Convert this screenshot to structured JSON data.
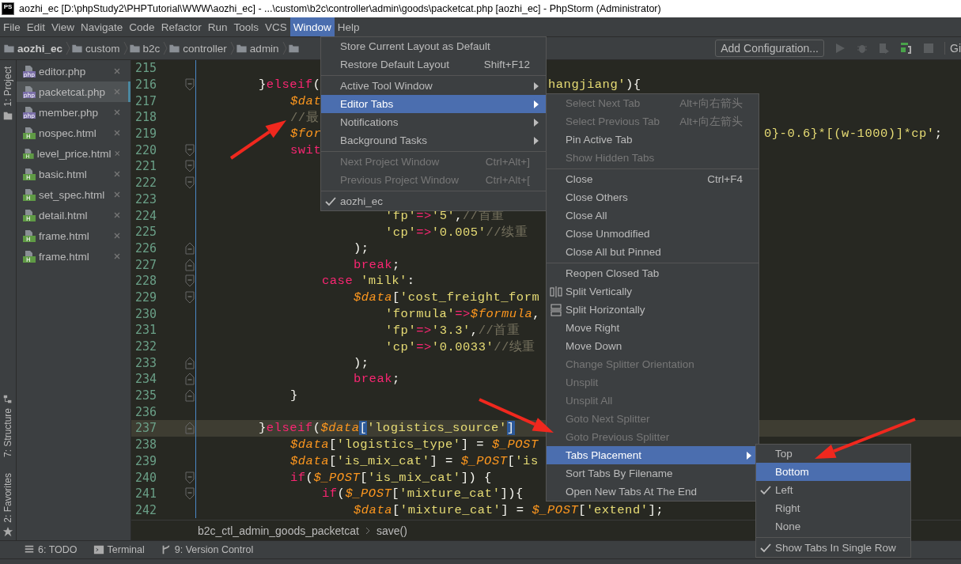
{
  "window": {
    "app_icon_text": "PS",
    "title": "aozhi_ec [D:\\phpStudy2\\PHPTutorial\\WWW\\aozhi_ec] - ...\\custom\\b2c\\controller\\admin\\goods\\packetcat.php [aozhi_ec] - PhpStorm (Administrator)"
  },
  "menu_bar": [
    {
      "label": "File",
      "selected": false
    },
    {
      "label": "Edit",
      "selected": false
    },
    {
      "label": "View",
      "selected": false
    },
    {
      "label": "Navigate",
      "selected": false
    },
    {
      "label": "Code",
      "selected": false
    },
    {
      "label": "Refactor",
      "selected": false
    },
    {
      "label": "Run",
      "selected": false
    },
    {
      "label": "Tools",
      "selected": false
    },
    {
      "label": "VCS",
      "selected": false
    },
    {
      "label": "Window",
      "selected": true
    },
    {
      "label": "Help",
      "selected": false
    }
  ],
  "navigation_bar": {
    "crumbs": [
      "aozhi_ec",
      "custom",
      "b2c",
      "controller",
      "admin"
    ],
    "run_config_button": "Add Configuration...",
    "vcs_label": "Gi"
  },
  "tool_windows_top": [
    {
      "label": "1: Project",
      "kind": "project"
    }
  ],
  "tool_windows_bottom": [
    {
      "label": "7: Structure",
      "kind": "structure"
    },
    {
      "label": "2: Favorites",
      "kind": "favorites"
    }
  ],
  "file_tabs": [
    {
      "name": "editor.php",
      "kind": "php",
      "badge": "php",
      "selected": false
    },
    {
      "name": "packetcat.php",
      "kind": "php",
      "badge": "php",
      "selected": true
    },
    {
      "name": "member.php",
      "kind": "php",
      "badge": "php",
      "selected": false
    },
    {
      "name": "nospec.html",
      "kind": "html",
      "badge": "H",
      "selected": false
    },
    {
      "name": "level_price.html",
      "kind": "html",
      "badge": "H",
      "selected": false
    },
    {
      "name": "basic.html",
      "kind": "html",
      "badge": "H",
      "selected": false
    },
    {
      "name": "set_spec.html",
      "kind": "html",
      "badge": "H",
      "selected": false
    },
    {
      "name": "detail.html",
      "kind": "html",
      "badge": "H",
      "selected": false
    },
    {
      "name": "frame.html",
      "kind": "html",
      "badge": "H",
      "selected": false
    },
    {
      "name": "frame.html",
      "kind": "html",
      "badge": "H",
      "selected": false
    }
  ],
  "editor": {
    "lines": [
      {
        "number": "215",
        "kind": "plain",
        "current": false
      },
      {
        "number": "216",
        "kind": "opener",
        "current": false,
        "tokens": [
          {
            "text": "        }",
            "kind": "plain"
          },
          {
            "text": "elseif",
            "kind": "keyword"
          },
          {
            "text": "(",
            "kind": "plain"
          }
        ],
        "tail": {
          "kind": "menu",
          "tokens": [
            {
              "text": "hangjiang'",
              "kind": "string"
            },
            {
              "text": "){",
              "kind": "plain"
            }
          ]
        }
      },
      {
        "number": "217",
        "kind": "plain",
        "current": false,
        "tokens": [
          {
            "text": "            $dat",
            "kind": "variable"
          }
        ]
      },
      {
        "number": "218",
        "kind": "plain",
        "current": false,
        "tokens": [
          {
            "text": "            //最",
            "kind": "comment"
          }
        ]
      },
      {
        "number": "219",
        "kind": "plain",
        "current": false,
        "tokens": [
          {
            "text": "            $for",
            "kind": "variable"
          }
        ],
        "tail": {
          "kind": "submenu",
          "tokens": [
            {
              "text": "0}-0.6}*[(w-1000)]*cp'",
              "kind": "string"
            },
            {
              "text": ";",
              "kind": "plain"
            }
          ]
        }
      },
      {
        "number": "220",
        "kind": "opener",
        "current": false,
        "tokens": [
          {
            "text": "            swit",
            "kind": "keyword"
          }
        ]
      },
      {
        "number": "221",
        "kind": "opener",
        "current": false
      },
      {
        "number": "222",
        "kind": "opener",
        "current": false
      },
      {
        "number": "223",
        "kind": "plain",
        "current": false
      },
      {
        "number": "224",
        "kind": "plain",
        "current": false,
        "tokens": [
          {
            "text": "                        'fp'",
            "kind": "string"
          },
          {
            "text": "=>",
            "kind": "operator"
          },
          {
            "text": "'5'",
            "kind": "string"
          },
          {
            "text": ",",
            "kind": "plain"
          },
          {
            "text": "//首重",
            "kind": "comment"
          }
        ]
      },
      {
        "number": "225",
        "kind": "plain",
        "current": false,
        "tokens": [
          {
            "text": "                        'cp'",
            "kind": "string"
          },
          {
            "text": "=>",
            "kind": "operator"
          },
          {
            "text": "'0.005'",
            "kind": "string"
          },
          {
            "text": "//续重",
            "kind": "comment"
          }
        ]
      },
      {
        "number": "226",
        "kind": "closer",
        "current": false,
        "tokens": [
          {
            "text": "                    );",
            "kind": "plain"
          }
        ]
      },
      {
        "number": "227",
        "kind": "closer",
        "current": false,
        "tokens": [
          {
            "text": "                    break",
            "kind": "keyword"
          },
          {
            "text": ";",
            "kind": "plain"
          }
        ]
      },
      {
        "number": "228",
        "kind": "opener",
        "current": false,
        "tokens": [
          {
            "text": "                case",
            "kind": "keyword"
          },
          {
            "text": " 'milk'",
            "kind": "string"
          },
          {
            "text": ":",
            "kind": "plain"
          }
        ]
      },
      {
        "number": "229",
        "kind": "opener",
        "current": false,
        "tokens": [
          {
            "text": "                    $data",
            "kind": "variable"
          },
          {
            "text": "[",
            "kind": "plain"
          },
          {
            "text": "'cost_freight_form",
            "kind": "string"
          }
        ]
      },
      {
        "number": "230",
        "kind": "plain",
        "current": false,
        "tokens": [
          {
            "text": "                        'formula'",
            "kind": "string"
          },
          {
            "text": "=>",
            "kind": "operator"
          },
          {
            "text": "$formula",
            "kind": "variable"
          },
          {
            "text": ",",
            "kind": "plain"
          }
        ]
      },
      {
        "number": "231",
        "kind": "plain",
        "current": false,
        "tokens": [
          {
            "text": "                        'fp'",
            "kind": "string"
          },
          {
            "text": "=>",
            "kind": "operator"
          },
          {
            "text": "'3.3'",
            "kind": "string"
          },
          {
            "text": ",",
            "kind": "plain"
          },
          {
            "text": "//首重",
            "kind": "comment"
          }
        ]
      },
      {
        "number": "232",
        "kind": "plain",
        "current": false,
        "tokens": [
          {
            "text": "                        'cp'",
            "kind": "string"
          },
          {
            "text": "=>",
            "kind": "operator"
          },
          {
            "text": "'0.0033'",
            "kind": "string"
          },
          {
            "text": "//续重",
            "kind": "comment"
          }
        ]
      },
      {
        "number": "233",
        "kind": "closer",
        "current": false,
        "tokens": [
          {
            "text": "                    );",
            "kind": "plain"
          }
        ]
      },
      {
        "number": "234",
        "kind": "closer",
        "current": false,
        "tokens": [
          {
            "text": "                    break",
            "kind": "keyword"
          },
          {
            "text": ";",
            "kind": "plain"
          }
        ]
      },
      {
        "number": "235",
        "kind": "closer",
        "current": false,
        "tokens": [
          {
            "text": "            }",
            "kind": "plain"
          }
        ]
      },
      {
        "number": "236",
        "kind": "plain",
        "current": false
      },
      {
        "number": "237",
        "kind": "closer",
        "current": true,
        "tokens": [
          {
            "text": "        }",
            "kind": "plain"
          },
          {
            "text": "elseif",
            "kind": "keyword"
          },
          {
            "text": "(",
            "kind": "plain"
          },
          {
            "text": "$data",
            "kind": "variable"
          },
          {
            "text": "[",
            "kind": "match"
          },
          {
            "text": "'logistics_source'",
            "kind": "string"
          },
          {
            "text": "]",
            "kind": "match"
          }
        ]
      },
      {
        "number": "238",
        "kind": "plain",
        "current": false,
        "tokens": [
          {
            "text": "            $data",
            "kind": "variable"
          },
          {
            "text": "[",
            "kind": "plain"
          },
          {
            "text": "'logistics_type'",
            "kind": "string"
          },
          {
            "text": "] = ",
            "kind": "plain"
          },
          {
            "text": "$_POST",
            "kind": "variable"
          }
        ]
      },
      {
        "number": "239",
        "kind": "plain",
        "current": false,
        "tokens": [
          {
            "text": "            $data",
            "kind": "variable"
          },
          {
            "text": "[",
            "kind": "plain"
          },
          {
            "text": "'is_mix_cat'",
            "kind": "string"
          },
          {
            "text": "] = ",
            "kind": "plain"
          },
          {
            "text": "$_POST",
            "kind": "variable"
          },
          {
            "text": "[",
            "kind": "plain"
          },
          {
            "text": "'is",
            "kind": "string"
          }
        ]
      },
      {
        "number": "240",
        "kind": "opener",
        "current": false,
        "tokens": [
          {
            "text": "            if",
            "kind": "keyword"
          },
          {
            "text": "(",
            "kind": "plain"
          },
          {
            "text": "$_POST",
            "kind": "variable"
          },
          {
            "text": "[",
            "kind": "plain"
          },
          {
            "text": "'is_mix_cat'",
            "kind": "string"
          },
          {
            "text": "]) {",
            "kind": "plain"
          }
        ]
      },
      {
        "number": "241",
        "kind": "opener",
        "current": false,
        "tokens": [
          {
            "text": "                if",
            "kind": "keyword"
          },
          {
            "text": "(",
            "kind": "plain"
          },
          {
            "text": "$_POST",
            "kind": "variable"
          },
          {
            "text": "[",
            "kind": "plain"
          },
          {
            "text": "'mixture_cat'",
            "kind": "string"
          },
          {
            "text": "]){",
            "kind": "plain"
          }
        ]
      },
      {
        "number": "242",
        "kind": "plain",
        "current": false,
        "tokens": [
          {
            "text": "                    $data",
            "kind": "variable"
          },
          {
            "text": "[",
            "kind": "plain"
          },
          {
            "text": "'mixture_cat'",
            "kind": "string"
          },
          {
            "text": "] = ",
            "kind": "plain"
          },
          {
            "text": "$_POST",
            "kind": "variable"
          },
          {
            "text": "[",
            "kind": "plain"
          },
          {
            "text": "'extend'",
            "kind": "string"
          },
          {
            "text": "];",
            "kind": "plain"
          }
        ]
      }
    ],
    "breadcrumb": [
      "b2c_ctl_admin_goods_packetcat",
      "save()"
    ]
  },
  "bottom_toolbar": [
    {
      "label": "6: TODO",
      "kind": "todo"
    },
    {
      "label": "Terminal",
      "kind": "terminal"
    },
    {
      "label": "9: Version Control",
      "kind": "vcs"
    }
  ],
  "window_menu": [
    {
      "kind": "item",
      "label": "Store Current Layout as Default",
      "submenu": false,
      "disabled": false,
      "selected": false,
      "checked": false
    },
    {
      "kind": "item",
      "label": "Restore Default Layout",
      "shortcut": "Shift+F12",
      "submenu": false,
      "disabled": false,
      "selected": false,
      "checked": false
    },
    {
      "kind": "separator"
    },
    {
      "kind": "item",
      "label": "Active Tool Window",
      "submenu": true,
      "disabled": false,
      "selected": false,
      "checked": false
    },
    {
      "kind": "item",
      "label": "Editor Tabs",
      "submenu": true,
      "disabled": false,
      "selected": true,
      "checked": false
    },
    {
      "kind": "item",
      "label": "Notifications",
      "submenu": true,
      "disabled": false,
      "selected": false,
      "checked": false
    },
    {
      "kind": "item",
      "label": "Background Tasks",
      "submenu": true,
      "disabled": false,
      "selected": false,
      "checked": false
    },
    {
      "kind": "separator"
    },
    {
      "kind": "item",
      "label": "Next Project Window",
      "shortcut": "Ctrl+Alt+]",
      "submenu": false,
      "disabled": true,
      "selected": false,
      "checked": false
    },
    {
      "kind": "item",
      "label": "Previous Project Window",
      "shortcut": "Ctrl+Alt+[",
      "submenu": false,
      "disabled": true,
      "selected": false,
      "checked": false
    },
    {
      "kind": "separator"
    },
    {
      "kind": "item",
      "label": "aozhi_ec",
      "submenu": false,
      "disabled": false,
      "selected": false,
      "checked": true
    }
  ],
  "editor_tabs_menu": [
    {
      "kind": "item",
      "label": "Select Next Tab",
      "shortcut": "Alt+向右箭头",
      "submenu": false,
      "disabled": true,
      "selected": false,
      "checked": false
    },
    {
      "kind": "item",
      "label": "Select Previous Tab",
      "shortcut": "Alt+向左箭头",
      "submenu": false,
      "disabled": true,
      "selected": false,
      "checked": false
    },
    {
      "kind": "item",
      "label": "Pin Active Tab",
      "submenu": false,
      "disabled": false,
      "selected": false,
      "checked": false
    },
    {
      "kind": "item",
      "label": "Show Hidden Tabs",
      "submenu": false,
      "disabled": true,
      "selected": false,
      "checked": false
    },
    {
      "kind": "separator"
    },
    {
      "kind": "item",
      "label": "Close",
      "shortcut": "Ctrl+F4",
      "submenu": false,
      "disabled": false,
      "selected": false,
      "checked": false
    },
    {
      "kind": "item",
      "label": "Close Others",
      "submenu": false,
      "disabled": false,
      "selected": false,
      "checked": false
    },
    {
      "kind": "item",
      "label": "Close All",
      "submenu": false,
      "disabled": false,
      "selected": false,
      "checked": false
    },
    {
      "kind": "item",
      "label": "Close Unmodified",
      "submenu": false,
      "disabled": false,
      "selected": false,
      "checked": false
    },
    {
      "kind": "item",
      "label": "Close All but Pinned",
      "submenu": false,
      "disabled": false,
      "selected": false,
      "checked": false
    },
    {
      "kind": "separator"
    },
    {
      "kind": "item",
      "label": "Reopen Closed Tab",
      "submenu": false,
      "disabled": false,
      "selected": false,
      "checked": false
    },
    {
      "kind": "vsplit",
      "label": "Split Vertically",
      "submenu": false,
      "disabled": false,
      "selected": false,
      "checked": false
    },
    {
      "kind": "hsplit",
      "label": "Split Horizontally",
      "submenu": false,
      "disabled": false,
      "selected": false,
      "checked": false
    },
    {
      "kind": "item",
      "label": "Move Right",
      "submenu": false,
      "disabled": false,
      "selected": false,
      "checked": false
    },
    {
      "kind": "item",
      "label": "Move Down",
      "submenu": false,
      "disabled": false,
      "selected": false,
      "checked": false
    },
    {
      "kind": "item",
      "label": "Change Splitter Orientation",
      "submenu": false,
      "disabled": true,
      "selected": false,
      "checked": false
    },
    {
      "kind": "item",
      "label": "Unsplit",
      "submenu": false,
      "disabled": true,
      "selected": false,
      "checked": false
    },
    {
      "kind": "item",
      "label": "Unsplit All",
      "submenu": false,
      "disabled": true,
      "selected": false,
      "checked": false
    },
    {
      "kind": "item",
      "label": "Goto Next Splitter",
      "submenu": false,
      "disabled": true,
      "selected": false,
      "checked": false
    },
    {
      "kind": "item",
      "label": "Goto Previous Splitter",
      "submenu": false,
      "disabled": true,
      "selected": false,
      "checked": false
    },
    {
      "kind": "item",
      "label": "Tabs Placement",
      "submenu": true,
      "disabled": false,
      "selected": true,
      "checked": false
    },
    {
      "kind": "item",
      "label": "Sort Tabs By Filename",
      "submenu": false,
      "disabled": false,
      "selected": false,
      "checked": false
    },
    {
      "kind": "item",
      "label": "Open New Tabs At The End",
      "submenu": false,
      "disabled": false,
      "selected": false,
      "checked": false
    }
  ],
  "tabs_placement_menu": [
    {
      "kind": "item",
      "label": "Top",
      "submenu": false,
      "disabled": false,
      "selected": false,
      "checked": false
    },
    {
      "kind": "item",
      "label": "Bottom",
      "submenu": false,
      "disabled": false,
      "selected": true,
      "checked": false
    },
    {
      "kind": "item",
      "label": "Left",
      "submenu": false,
      "disabled": false,
      "selected": false,
      "checked": true
    },
    {
      "kind": "item",
      "label": "Right",
      "submenu": false,
      "disabled": false,
      "selected": false,
      "checked": false
    },
    {
      "kind": "item",
      "label": "None",
      "submenu": false,
      "disabled": false,
      "selected": false,
      "checked": false
    },
    {
      "kind": "separator"
    },
    {
      "kind": "item",
      "label": "Show Tabs In Single Row",
      "submenu": false,
      "disabled": false,
      "selected": false,
      "checked": true
    }
  ]
}
